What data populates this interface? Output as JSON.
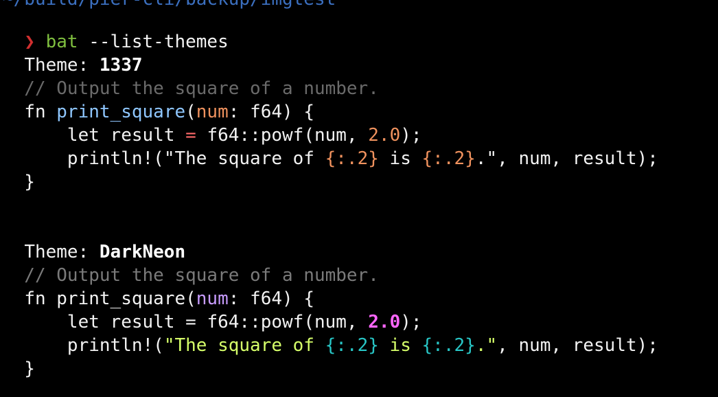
{
  "terminal": {
    "cut_path": "~/build/pier-cli/backup/imgtest",
    "prompt_caret": "❯",
    "command_bin": "bat",
    "command_args": " --list-themes",
    "theme_label": "Theme: ",
    "themes": [
      {
        "name": "1337",
        "lines": [
          "  // Output the square of a number.",
          "  fn print_square(num: f64) {",
          "      let result = f64::powf(num, 2.0);",
          "      println!(\"The square of {:.2} is {:.2}.\", num, result);",
          "  }"
        ]
      },
      {
        "name": "DarkNeon",
        "lines": [
          "  // Output the square of a number.",
          "  fn print_square(num: f64) {",
          "      let result = f64::powf(num, 2.0);",
          "      println!(\"The square of {:.2} is {:.2}.\", num, result);",
          "  }"
        ]
      }
    ]
  }
}
